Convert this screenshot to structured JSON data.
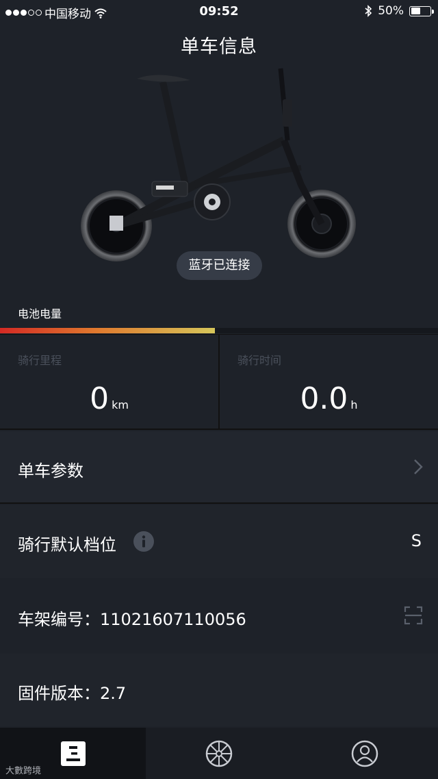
{
  "status_bar": {
    "carrier": "中国移动",
    "time": "09:52",
    "battery_percent": "50%",
    "battery_level": 0.5,
    "icons": [
      "signal-dots-icon",
      "wifi-icon",
      "bluetooth-icon",
      "battery-icon"
    ]
  },
  "header": {
    "title": "单车信息"
  },
  "bike": {
    "icon": "bike-image",
    "connection_status": "蓝牙已连接"
  },
  "battery": {
    "label": "电池电量",
    "level": 0.49,
    "gradient": [
      "#d42a24",
      "#e07a2e",
      "#d6c65a"
    ]
  },
  "stats": {
    "distance": {
      "label": "骑行里程",
      "value": "0",
      "unit": "km"
    },
    "time": {
      "label": "骑行时间",
      "value": "0.0",
      "unit": "h"
    }
  },
  "rows": {
    "params": {
      "label": "单车参数",
      "icon": "chevron-right-icon"
    },
    "gear": {
      "label": "骑行默认档位",
      "info_icon": "info-icon",
      "value": "S"
    },
    "frame": {
      "label": "车架编号：11021607110056",
      "icon": "scan-icon"
    },
    "firmware": {
      "label": "固件版本：2.7"
    }
  },
  "tabs": [
    {
      "icon": "document-icon",
      "active": true
    },
    {
      "icon": "wheel-icon",
      "active": false
    },
    {
      "icon": "profile-icon",
      "active": false
    }
  ],
  "watermark": {
    "text": "大數跨境"
  },
  "colors": {
    "background": "#1e2229",
    "muted_text": "#4a505b",
    "pill": "#363c47"
  }
}
